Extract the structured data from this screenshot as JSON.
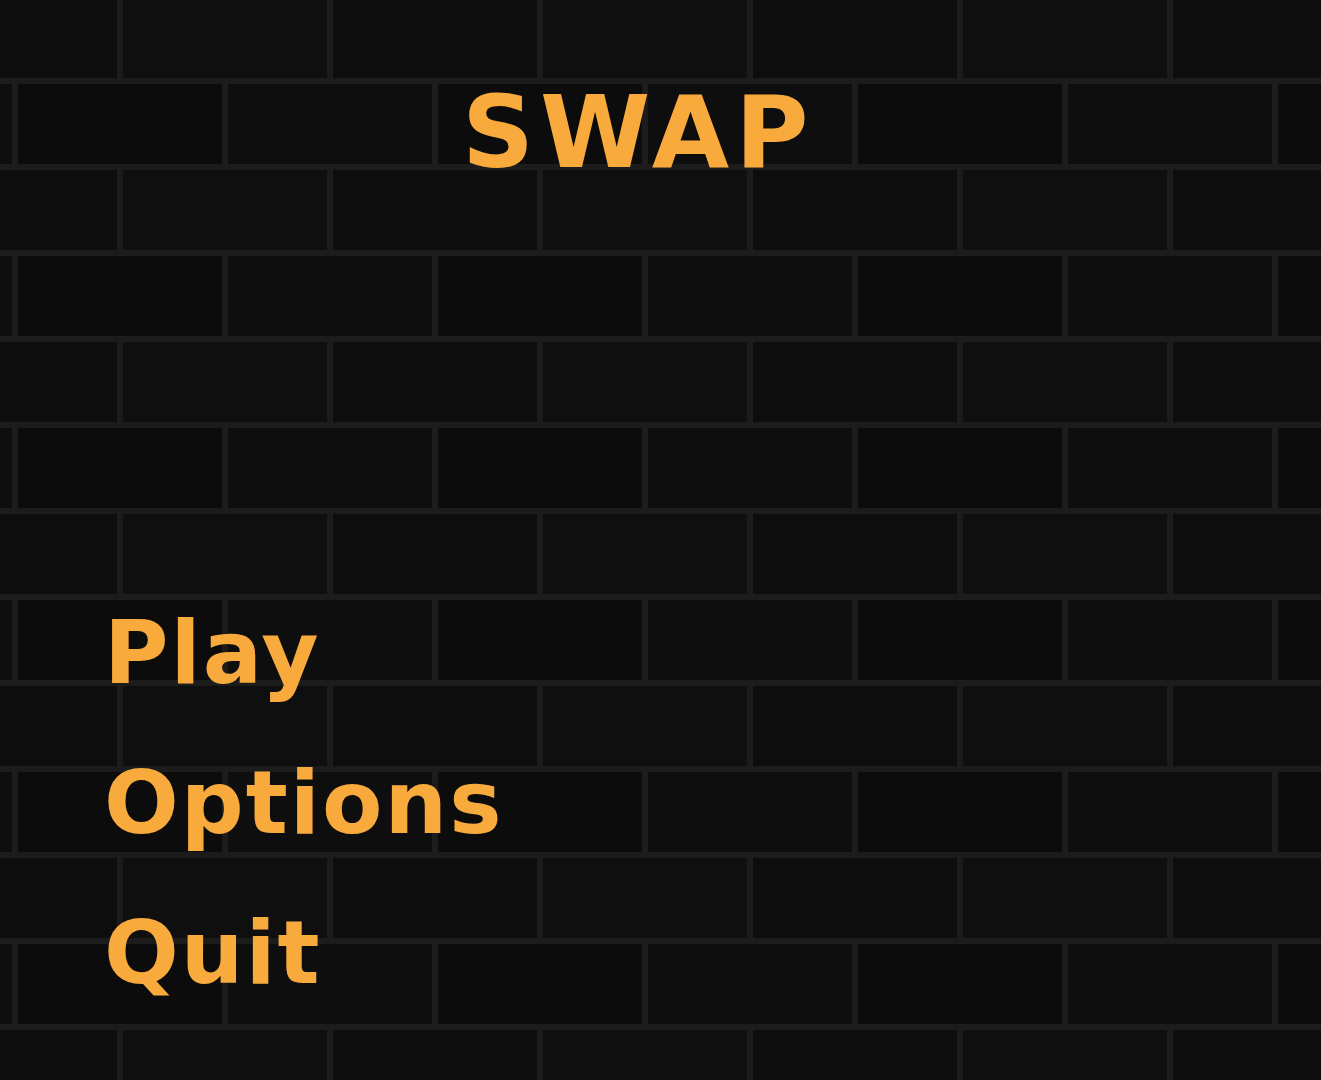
{
  "title": "SWAP",
  "menu": [
    {
      "label": "Play"
    },
    {
      "label": "Options"
    },
    {
      "label": "Quit"
    }
  ]
}
